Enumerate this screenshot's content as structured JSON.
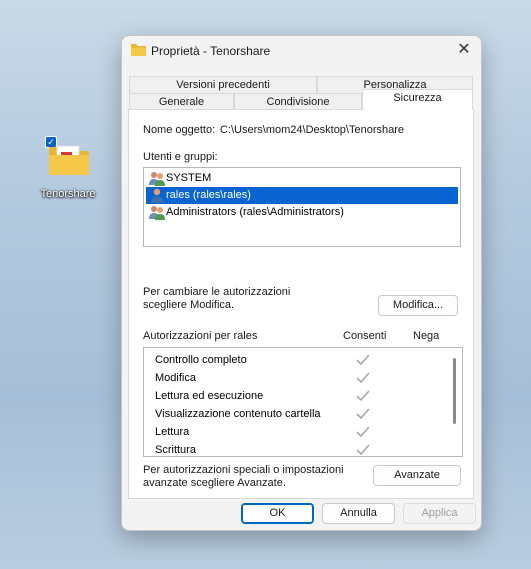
{
  "desktop": {
    "icon_label": "Tenorshare"
  },
  "window": {
    "title": "Proprietà - Tenorshare",
    "close_glyph": "✕",
    "tabs_row1": [
      "Versioni precedenti",
      "Personalizza"
    ],
    "tabs_row2": [
      "Generale",
      "Condivisione",
      "Sicurezza"
    ],
    "active_tab": "Sicurezza"
  },
  "security": {
    "object_name_label": "Nome oggetto:",
    "object_name_value": "C:\\Users\\mom24\\Desktop\\Tenorshare",
    "users_groups_label": "Utenti e gruppi:",
    "users": [
      {
        "name": "SYSTEM",
        "icon": "group-icon",
        "selected": false
      },
      {
        "name": "rales (rales\\rales)",
        "icon": "user-icon",
        "selected": true
      },
      {
        "name": "Administrators (rales\\Administrators)",
        "icon": "group-icon",
        "selected": false
      }
    ],
    "change_text_line1": "Per cambiare le autorizzazioni",
    "change_text_line2": "scegliere Modifica.",
    "modify_button": "Modifica...",
    "permissions_label": "Autorizzazioni per rales",
    "allow_header": "Consenti",
    "deny_header": "Nega",
    "permissions": [
      {
        "name": "Controllo completo",
        "allow": true,
        "deny": false
      },
      {
        "name": "Modifica",
        "allow": true,
        "deny": false
      },
      {
        "name": "Lettura ed esecuzione",
        "allow": true,
        "deny": false
      },
      {
        "name": "Visualizzazione contenuto cartella",
        "allow": true,
        "deny": false
      },
      {
        "name": "Lettura",
        "allow": true,
        "deny": false
      },
      {
        "name": "Scrittura",
        "allow": true,
        "deny": false
      }
    ],
    "advanced_text_line1": "Per autorizzazioni speciali o impostazioni",
    "advanced_text_line2": "avanzate scegliere Avanzate.",
    "advanced_button": "Avanzate"
  },
  "footer": {
    "ok": "OK",
    "cancel": "Annulla",
    "apply": "Applica"
  },
  "colors": {
    "selection": "#0a64d0",
    "accent": "#0067c0"
  }
}
